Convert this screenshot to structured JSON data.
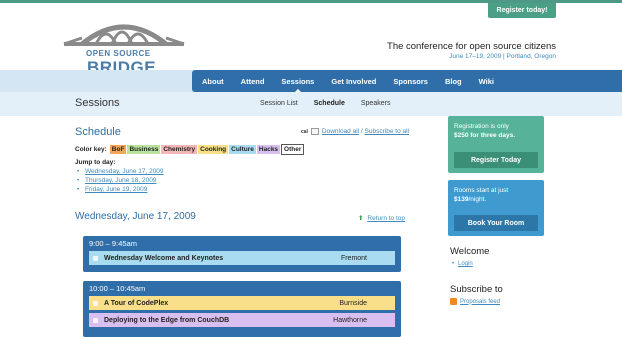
{
  "header": {
    "register_tab": "Register today!",
    "logo_line1": "OPEN SOURCE",
    "logo_line2": "BRIDGE",
    "tagline": "The conference for open source citizens",
    "dates": "June 17–19, 2009 | Portland, Oregon"
  },
  "nav": {
    "items": [
      "About",
      "Attend",
      "Sessions",
      "Get Involved",
      "Sponsors",
      "Blog",
      "Wiki"
    ],
    "active": "Sessions"
  },
  "subheader": {
    "title": "Sessions",
    "links": [
      "Session List",
      "Schedule",
      "Speakers"
    ],
    "active": "Schedule"
  },
  "schedule": {
    "title": "Schedule",
    "ical_label": "cal",
    "download_all": "Download all",
    "separator": "/",
    "subscribe_all": "Subscribe to all",
    "color_key_label": "Color key:",
    "color_key": [
      {
        "label": "BoF",
        "color": "#f2a65a"
      },
      {
        "label": "Business",
        "color": "#b9e39a"
      },
      {
        "label": "Chemistry",
        "color": "#f4b7b7"
      },
      {
        "label": "Cooking",
        "color": "#f9df8a"
      },
      {
        "label": "Culture",
        "color": "#a9dcf0"
      },
      {
        "label": "Hacks",
        "color": "#d8bff0"
      },
      {
        "label": "Other",
        "color": "#ffffff"
      }
    ],
    "jump_label": "Jump to day:",
    "jump_days": [
      "Wednesday, June 17, 2009",
      "Thursday, June 18, 2009",
      "Friday, June 19, 2009"
    ],
    "day_heading": "Wednesday, June 17, 2009",
    "return_top": "Return to top",
    "slots": [
      {
        "time": "9:00 – 9:45am",
        "sessions": [
          {
            "title": "Wednesday Welcome and Keynotes",
            "room": "Fremont",
            "color": "#a9dcf0"
          }
        ]
      },
      {
        "time": "10:00 – 10:45am",
        "sessions": [
          {
            "title": "A Tour of CodePlex",
            "room": "Burnside",
            "color": "#f9df8a"
          },
          {
            "title": "Deploying to the Edge from CouchDB",
            "room": "Hawthorne",
            "color": "#d8bff0"
          }
        ]
      }
    ]
  },
  "sidebar": {
    "registration_text_1": "Registration is only",
    "registration_text_2": "$250 for three days.",
    "register_button": "Register Today",
    "rooms_text_1": "Rooms start at just",
    "rooms_price": "$139",
    "rooms_text_2": "/night.",
    "book_button": "Book Your Room",
    "welcome_heading": "Welcome",
    "login_link": "Login",
    "subscribe_heading": "Subscribe to",
    "proposals_feed": "Proposals feed"
  },
  "colors": {
    "nav_blue": "#2f6ea8",
    "teal": "#57b29a",
    "light_blue": "#3f9ad0"
  }
}
